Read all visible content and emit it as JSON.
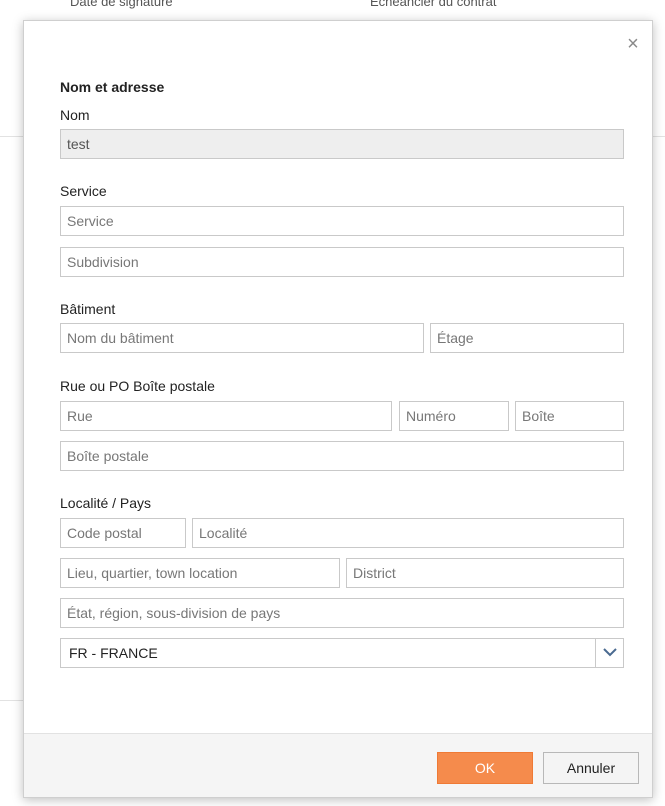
{
  "background": {
    "left_text": "Date de signature",
    "right_text": "Echéancier du contrat"
  },
  "dialog": {
    "close_symbol": "×",
    "section_name_address": "Nom et adresse",
    "nom": {
      "label": "Nom",
      "value": "test"
    },
    "service": {
      "label": "Service",
      "service_placeholder": "Service",
      "subdivision_placeholder": "Subdivision"
    },
    "batiment": {
      "label": "Bâtiment",
      "nom_batiment_placeholder": "Nom du bâtiment",
      "etage_placeholder": "Étage"
    },
    "rue": {
      "label": "Rue ou PO Boîte postale",
      "rue_placeholder": "Rue",
      "numero_placeholder": "Numéro",
      "boite_placeholder": "Boîte",
      "boite_postale_placeholder": "Boîte postale"
    },
    "localite": {
      "label": "Localité / Pays",
      "code_postal_placeholder": "Code postal",
      "localite_placeholder": "Localité",
      "lieu_placeholder": "Lieu, quartier, town location",
      "district_placeholder": "District",
      "etat_placeholder": "État, région, sous-division de pays",
      "country_selected": "FR - FRANCE"
    },
    "footer": {
      "ok_label": "OK",
      "cancel_label": "Annuler"
    }
  },
  "colors": {
    "accent": "#f58b4c",
    "border": "#c9c9c9",
    "footer_bg": "#f5f5f5"
  },
  "icons": {
    "close": "close-icon",
    "dropdown": "chevron-down-icon"
  }
}
